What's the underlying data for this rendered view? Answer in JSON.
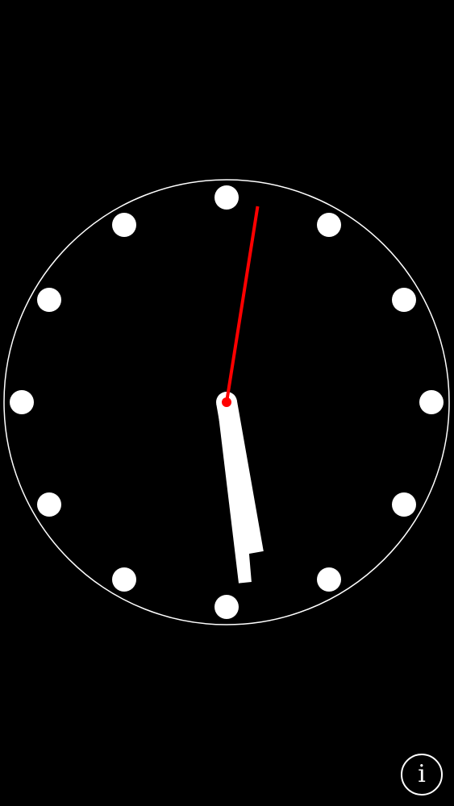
{
  "clock": {
    "time": {
      "hours": 5,
      "minutes": 32,
      "seconds": 1.5
    },
    "colors": {
      "background": "#000000",
      "face_outline": "#ffffff",
      "markers": "#ffffff",
      "hour_hand": "#ffffff",
      "minute_hand": "#ffffff",
      "second_hand": "#ff0000",
      "center_dot": "#ff0000"
    },
    "marker_count": 12
  },
  "info_button": {
    "label": "i",
    "icon": "info-icon"
  }
}
